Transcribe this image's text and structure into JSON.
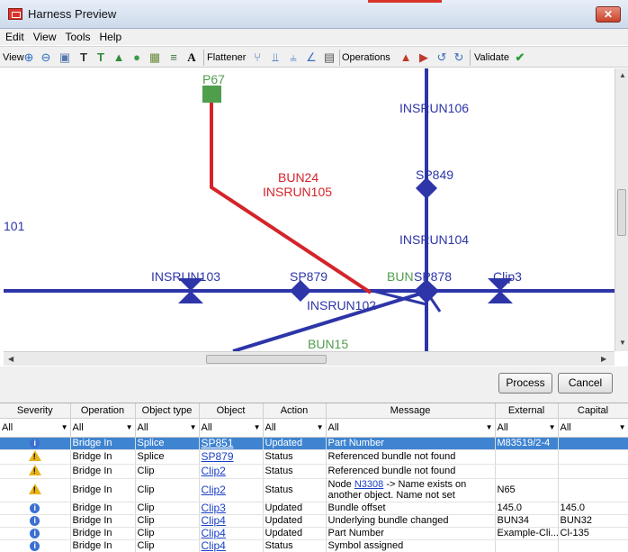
{
  "window": {
    "title": "Harness Preview",
    "close_label": "✕"
  },
  "menu": [
    "Edit",
    "View",
    "Tools",
    "Help"
  ],
  "toolbar": {
    "view_label": "View",
    "flattener_label": "Flattener",
    "operations_label": "Operations",
    "validate_label": "Validate",
    "icons": [
      "zoom-in-icon",
      "zoom-out-icon",
      "zoom-fit-icon",
      "text-tool-icon",
      "text-tool-green-icon",
      "tree-icon",
      "node-icon",
      "grid-icon",
      "layers-icon",
      "text-a-icon"
    ]
  },
  "canvas": {
    "labels": {
      "p67": "P67",
      "insrun106": "INSRUN106",
      "bun24": "BUN24",
      "insrun105": "INSRUN105",
      "sp849": "SP849",
      "n101": "101",
      "insrun104": "INSRUN104",
      "insrun103": "INSRUN103",
      "sp879": "SP879",
      "bunsp878_a": "BUN",
      "bunsp878_b": "SP878",
      "clip3": "Clip3",
      "insrun102": "INSRUN102",
      "bun15": "BUN15"
    },
    "colors": {
      "wire_blue": "#2d35a8",
      "wire_red": "#d4242a",
      "green": "#4f9e4c"
    }
  },
  "buttons": {
    "process": "Process",
    "cancel": "Cancel"
  },
  "grid": {
    "columns": [
      "Severity",
      "Operation",
      "Object type",
      "Object",
      "Action",
      "Message",
      "External",
      "Capital"
    ],
    "filters": [
      "All",
      "All",
      "All",
      "All",
      "All",
      "All",
      "All",
      "All"
    ],
    "rows": [
      {
        "sev": "info",
        "op": "Bridge In",
        "type": "Splice",
        "obj": "SP851",
        "action": "Updated",
        "msg": "Part Number",
        "ext": "M83519/2-4",
        "cap": "",
        "selected": true
      },
      {
        "sev": "warn",
        "op": "Bridge In",
        "type": "Splice",
        "obj": "SP879",
        "action": "Status",
        "msg": "Referenced bundle not found",
        "ext": "",
        "cap": ""
      },
      {
        "sev": "warn",
        "op": "Bridge In",
        "type": "Clip",
        "obj": "Clip2",
        "action": "Status",
        "msg": "Referenced bundle not found",
        "ext": "",
        "cap": ""
      },
      {
        "sev": "warn",
        "op": "Bridge In",
        "type": "Clip",
        "obj": "Clip2",
        "action": "Status",
        "msg_pre": "Node ",
        "msg_link": "N3308",
        "msg_post": " -> Name exists on another object. Name not set",
        "ext": "N65",
        "cap": "",
        "tall": true
      },
      {
        "sev": "info",
        "op": "Bridge In",
        "type": "Clip",
        "obj": "Clip3",
        "action": "Updated",
        "msg": "Bundle offset",
        "ext": "145.0",
        "cap": "145.0"
      },
      {
        "sev": "info",
        "op": "Bridge In",
        "type": "Clip",
        "obj": "Clip4",
        "action": "Updated",
        "msg": "Underlying bundle changed",
        "ext": "BUN34",
        "cap": "BUN32"
      },
      {
        "sev": "info",
        "op": "Bridge In",
        "type": "Clip",
        "obj": "Clip4",
        "action": "Updated",
        "msg": "Part Number",
        "ext": "Example-Cli...",
        "cap": "Cl-135"
      },
      {
        "sev": "info",
        "op": "Bridge In",
        "type": "Clip",
        "obj": "Clip4",
        "action": "Status",
        "msg": "Symbol assigned",
        "ext": "",
        "cap": ""
      }
    ]
  }
}
